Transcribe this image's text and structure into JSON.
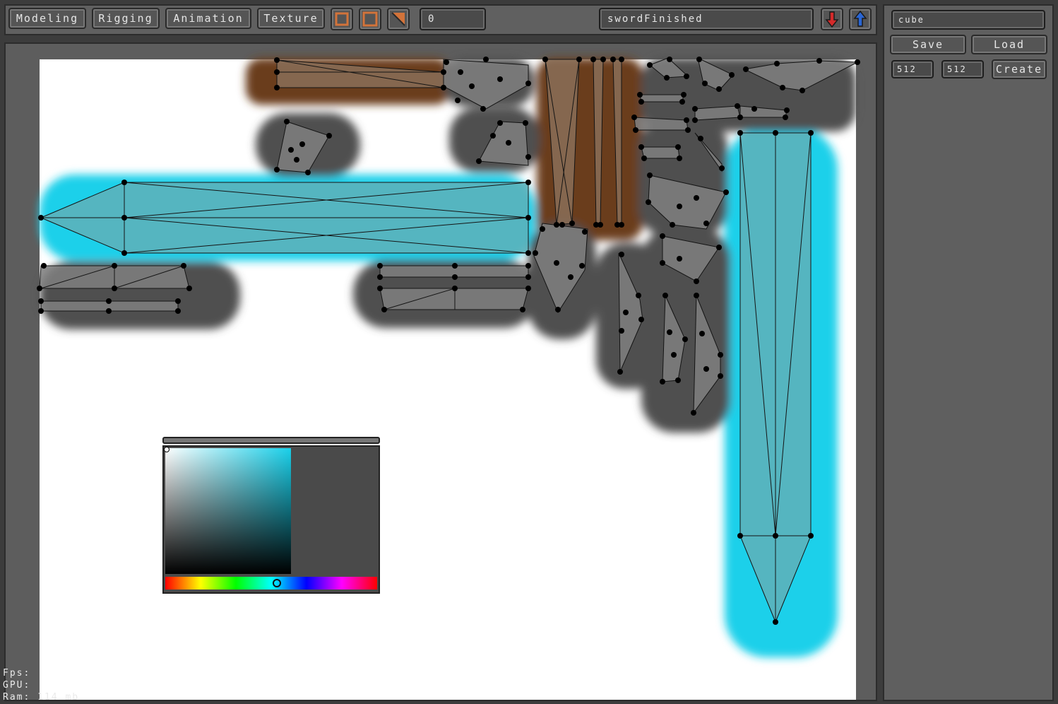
{
  "toolbar": {
    "tabs": [
      {
        "label": "Modeling"
      },
      {
        "label": "Rigging"
      },
      {
        "label": "Animation"
      },
      {
        "label": "Texture"
      }
    ],
    "frame_value": "0",
    "file_name": "swordFinished",
    "down_icon": "arrow-down-icon",
    "up_icon": "arrow-up-icon"
  },
  "side_panel": {
    "object_name": "cube",
    "save_label": "Save",
    "load_label": "Load",
    "width_value": "512",
    "height_value": "512",
    "create_label": "Create"
  },
  "stats": {
    "fps_label": "Fps:",
    "gpu_label": "GPU:",
    "ram_label": "Ram:",
    "ram_value": "114 mb"
  },
  "colors": {
    "accent_orange": "#d2733a",
    "selection_cyan": "#1ad0ea",
    "brown_region": "#6b3e1c",
    "down_arrow": "#d42a2a",
    "up_arrow": "#2a66d4"
  }
}
